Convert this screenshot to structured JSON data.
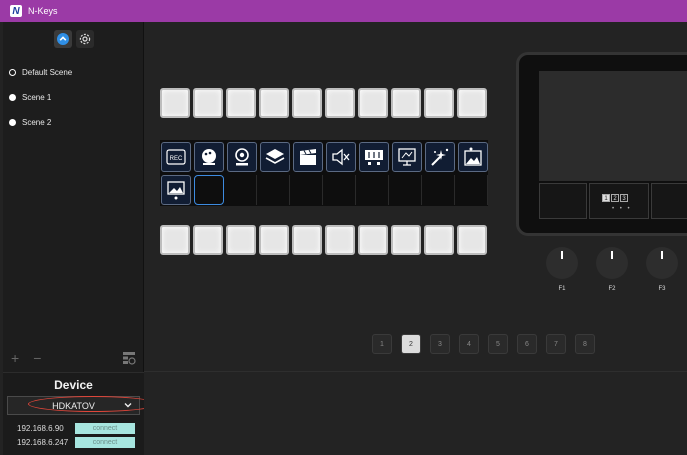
{
  "window": {
    "title": "N-Keys",
    "logo_letter": "N"
  },
  "scenes": [
    {
      "label": "Default Scene",
      "selected": true
    },
    {
      "label": "Scene 1",
      "selected": false
    },
    {
      "label": "Scene 2",
      "selected": false
    }
  ],
  "toolbar": {
    "add": "+",
    "remove": "−"
  },
  "device": {
    "title": "Device",
    "selected": "HDKATOV",
    "entries": [
      {
        "ip": "192.168.6.90",
        "action": "connect"
      },
      {
        "ip": "192.168.6.247",
        "action": "connect"
      }
    ]
  },
  "icons": [
    "rec-icon",
    "palette-icon",
    "webcam-icon",
    "layers-icon",
    "clapper-icon",
    "mute-icon",
    "mixer-icon",
    "screen-icon",
    "effects-icon",
    "image-icon",
    "image-frame-icon"
  ],
  "knobs": [
    "F1",
    "F2",
    "F3"
  ],
  "preview": {
    "pages": [
      "1",
      "2",
      "3"
    ],
    "active": "1",
    "dots": "• • •"
  },
  "pages": [
    "1",
    "2",
    "3",
    "4",
    "5",
    "6",
    "7",
    "8"
  ],
  "active_page": "2",
  "colors": {
    "titlebar": "#9b3aa6",
    "accent": "#3d8be0",
    "connect": "#a7e5df",
    "annotation": "#e0463a"
  }
}
